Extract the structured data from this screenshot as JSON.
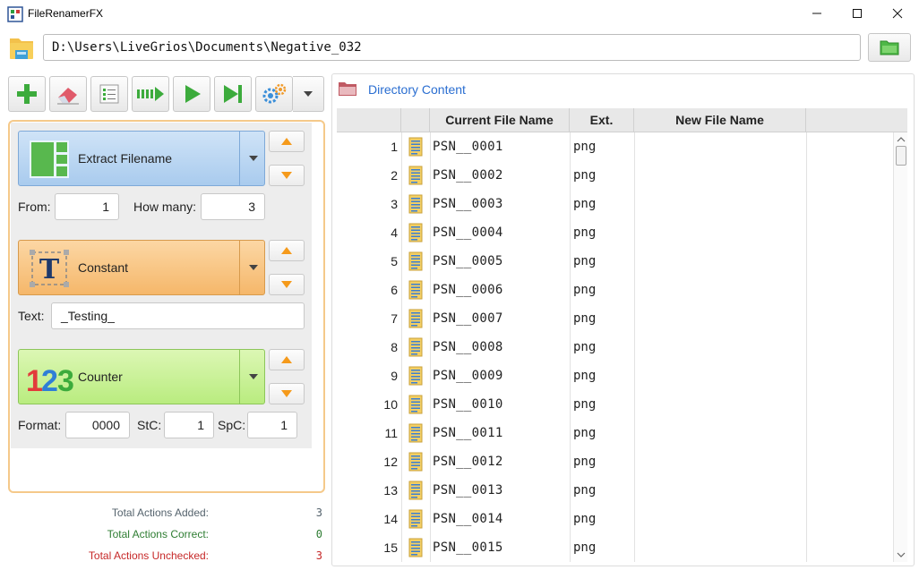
{
  "window": {
    "title": "FileRenamerFX",
    "minimize_icon": "minimize-icon",
    "maximize_icon": "maximize-icon",
    "close_icon": "close-icon"
  },
  "path": {
    "value": "D:\\Users\\LiveGrios\\Documents\\Negative_032"
  },
  "toolbar": {
    "buttons": [
      "add-action",
      "clear-actions",
      "checklist",
      "rename-step",
      "run",
      "run-to-end",
      "settings"
    ]
  },
  "actions": [
    {
      "label": "Extract Filename",
      "color": "#a9cbee",
      "icon": "layout-blocks-icon",
      "fields": [
        {
          "label": "From:",
          "value": "1"
        },
        {
          "label": "How many:",
          "value": "3"
        }
      ]
    },
    {
      "label": "Constant",
      "color": "#f5b76a",
      "icon": "text-t-icon",
      "fields": [
        {
          "label": "Text:",
          "value": "_Testing_"
        }
      ]
    },
    {
      "label": "Counter",
      "color": "#b9ec7f",
      "icon": "numbers-123-icon",
      "fields": [
        {
          "label": "Format:",
          "value": "0000"
        },
        {
          "label": "StC:",
          "value": "1"
        },
        {
          "label": "SpC:",
          "value": "1"
        }
      ]
    }
  ],
  "totals": {
    "added_label": "Total Actions Added:",
    "added_value": "3",
    "correct_label": "Total Actions Correct:",
    "correct_value": "0",
    "unchecked_label": "Total Actions Unchecked:",
    "unchecked_value": "3",
    "colors": {
      "added": "#55636d",
      "correct": "#2e7d32",
      "unchecked": "#c62828"
    }
  },
  "directory": {
    "title": "Directory Content",
    "columns": [
      "Current File Name",
      "Ext.",
      "New File Name"
    ],
    "rows": [
      {
        "num": "1",
        "name": "PSN__0001",
        "ext": "png",
        "new": ""
      },
      {
        "num": "2",
        "name": "PSN__0002",
        "ext": "png",
        "new": ""
      },
      {
        "num": "3",
        "name": "PSN__0003",
        "ext": "png",
        "new": ""
      },
      {
        "num": "4",
        "name": "PSN__0004",
        "ext": "png",
        "new": ""
      },
      {
        "num": "5",
        "name": "PSN__0005",
        "ext": "png",
        "new": ""
      },
      {
        "num": "6",
        "name": "PSN__0006",
        "ext": "png",
        "new": ""
      },
      {
        "num": "7",
        "name": "PSN__0007",
        "ext": "png",
        "new": ""
      },
      {
        "num": "8",
        "name": "PSN__0008",
        "ext": "png",
        "new": ""
      },
      {
        "num": "9",
        "name": "PSN__0009",
        "ext": "png",
        "new": ""
      },
      {
        "num": "10",
        "name": "PSN__0010",
        "ext": "png",
        "new": ""
      },
      {
        "num": "11",
        "name": "PSN__0011",
        "ext": "png",
        "new": ""
      },
      {
        "num": "12",
        "name": "PSN__0012",
        "ext": "png",
        "new": ""
      },
      {
        "num": "13",
        "name": "PSN__0013",
        "ext": "png",
        "new": ""
      },
      {
        "num": "14",
        "name": "PSN__0014",
        "ext": "png",
        "new": ""
      },
      {
        "num": "15",
        "name": "PSN__0015",
        "ext": "png",
        "new": ""
      }
    ]
  },
  "colors": {
    "accent_blue": "#2a6ed1",
    "panel_border": "#f5c98a"
  }
}
